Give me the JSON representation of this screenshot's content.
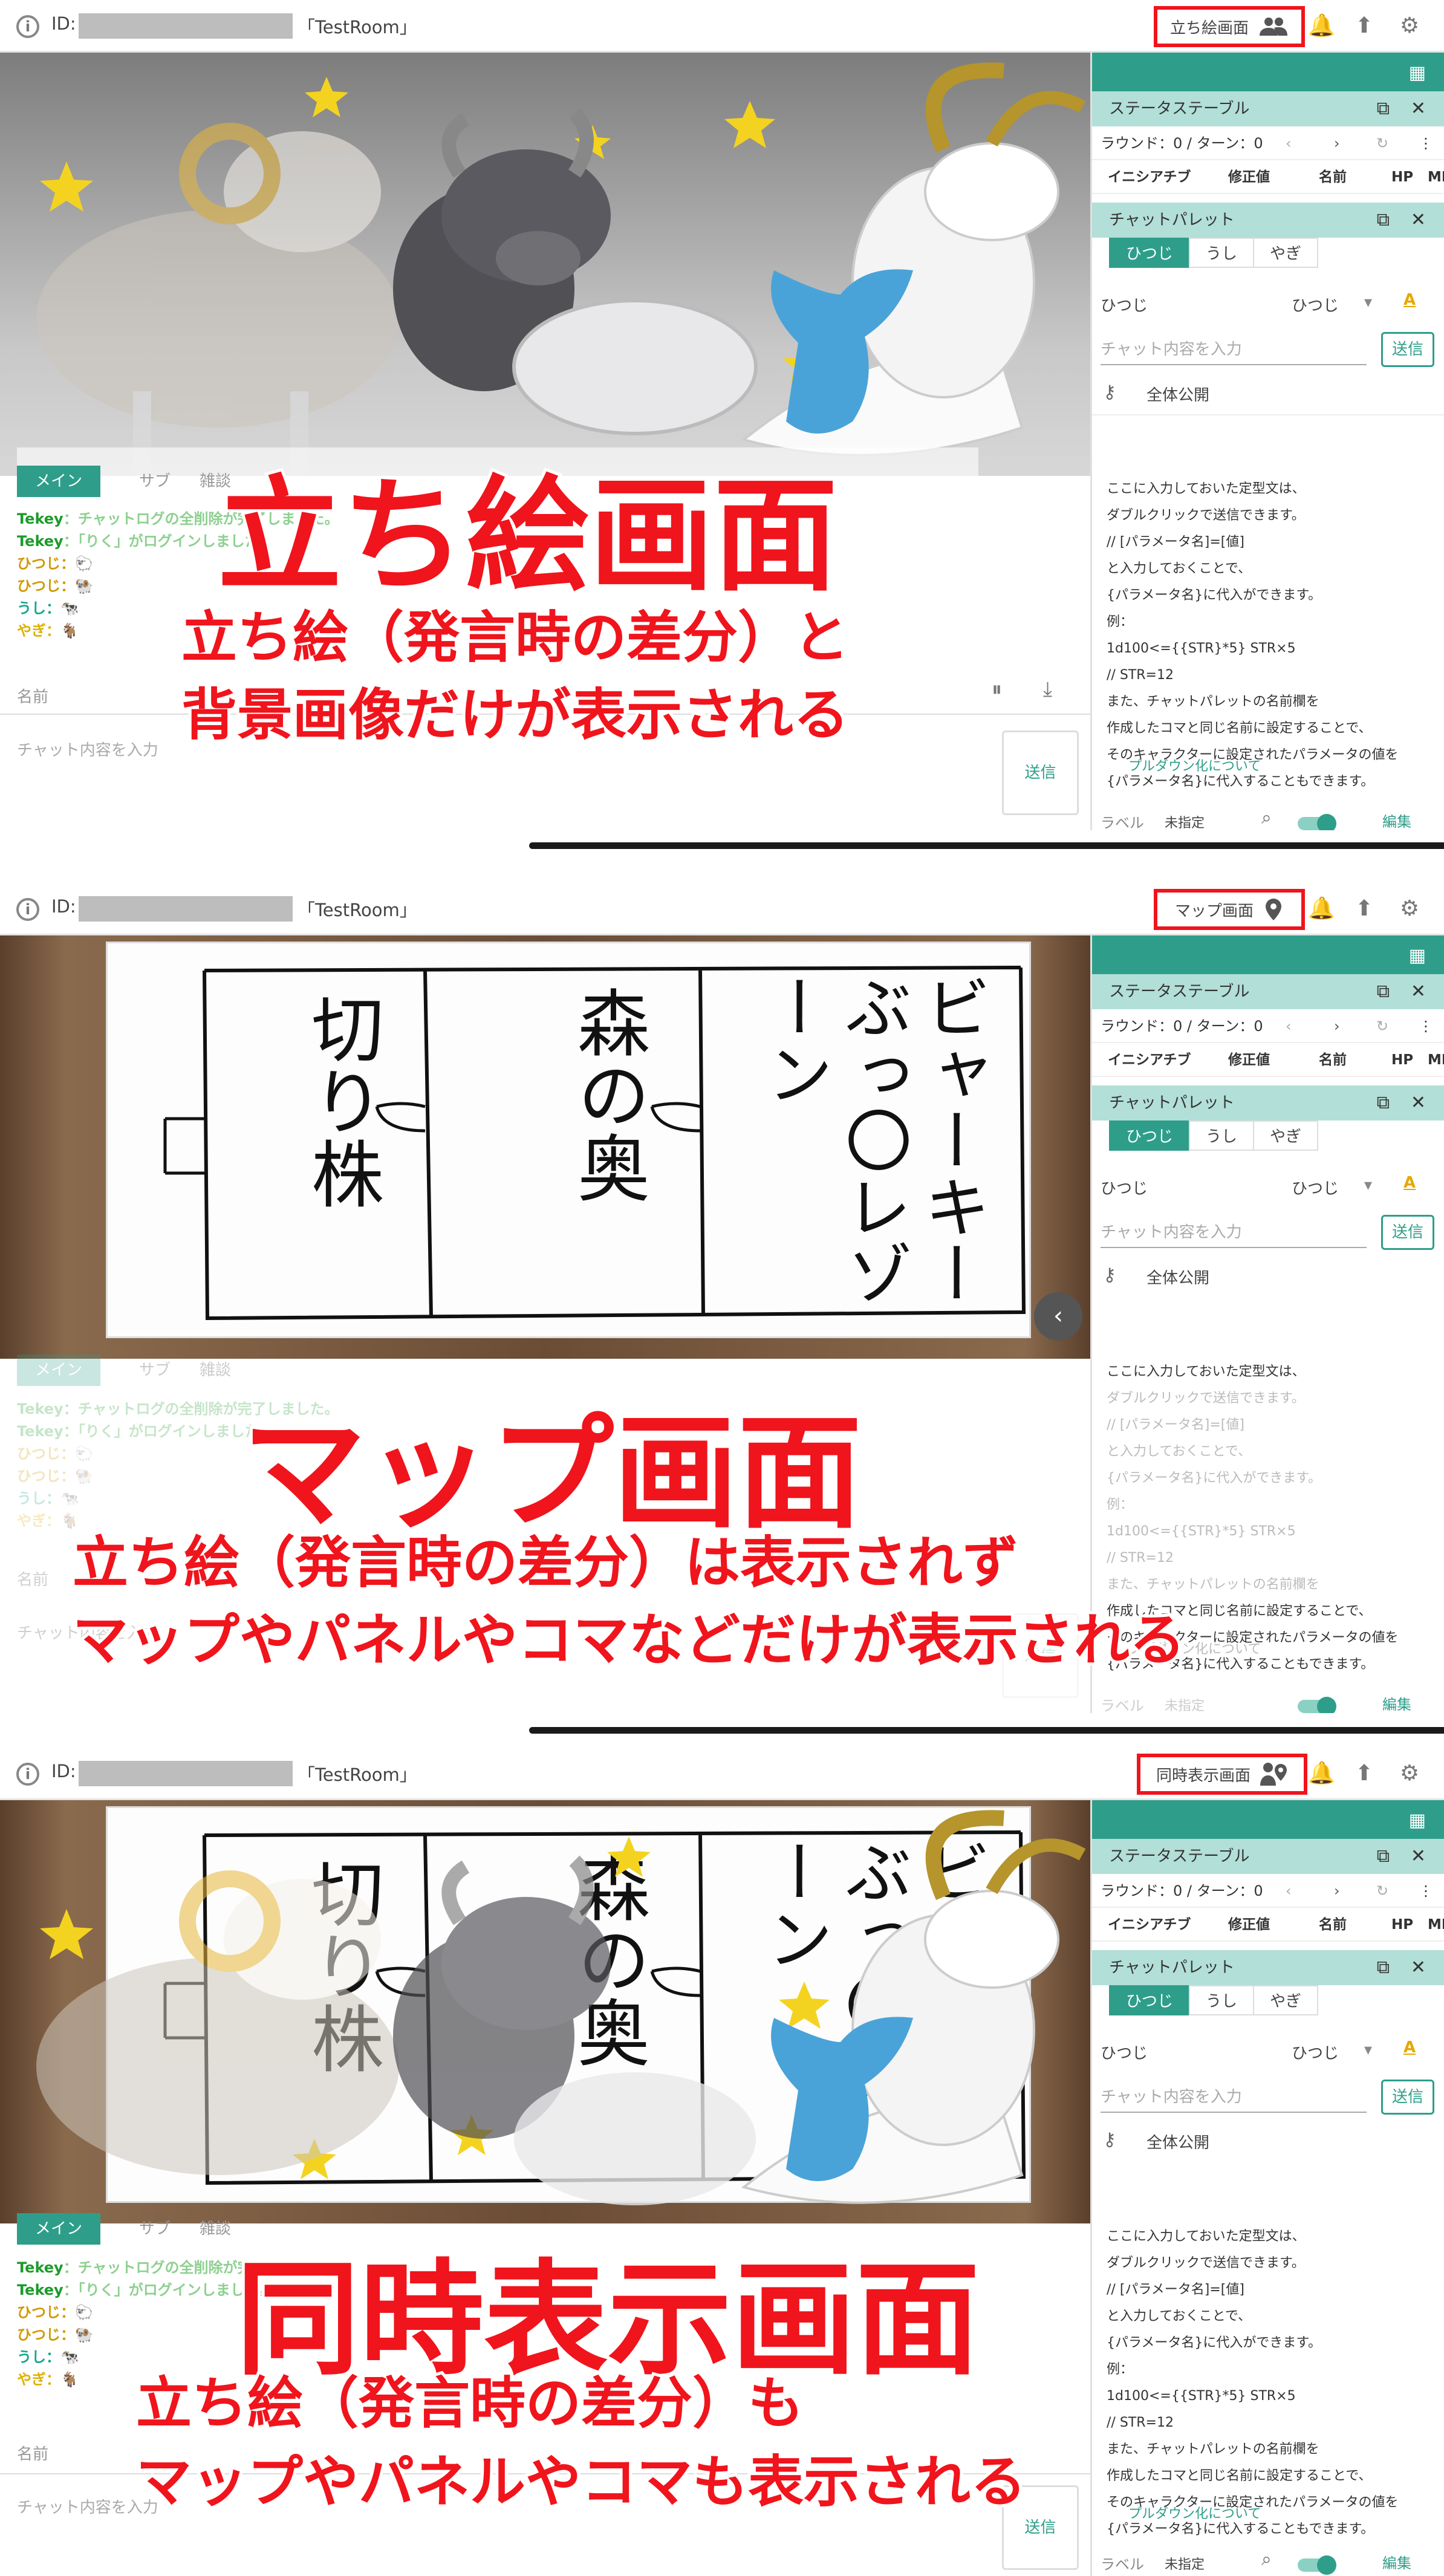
{
  "common": {
    "id_label": "ID:",
    "room_name": "「TestRoom」",
    "sidebar": {
      "status_table": "ステータステーブル",
      "round_turn": "ラウンド：0 / ターン：0",
      "columns": [
        "イニシアチブ",
        "修正値",
        "名前",
        "HP",
        "MP"
      ],
      "chat_palette": "チャットパレット",
      "palette_tabs": [
        "ひつじ",
        "うし",
        "やぎ"
      ],
      "speaker_label": "ひつじ",
      "speaker_select": "ひつじ",
      "chat_placeholder": "チャット内容を入力",
      "send": "送信",
      "visibility": "全体公開",
      "help_lines": [
        "ここに入力しておいた定型文は、",
        "ダブルクリックで送信できます。",
        "// [パラメータ名]=[値]",
        "と入力しておくことで、",
        "{パラメータ名}に代入ができます。",
        "例：",
        "1d100<={{STR}*5} STR×5",
        "// STR=12",
        "また、チャットパレットの名前欄を",
        "作成したコマと同じ名前に設定することで、",
        "そのキャラクターに設定されたパラメータの値を",
        "{パラメータ名}に代入することもできます。"
      ],
      "pulldown": "プルダウン化について",
      "label_text": "ラベル",
      "label_value": "未指定",
      "edit": "編集"
    },
    "chat": {
      "tabs": [
        "メイン",
        "サブ",
        "雑談"
      ],
      "log": [
        {
          "name": "Tekey",
          "text": "：チャットログの全削除が完了しました。"
        },
        {
          "name": "Tekey",
          "text": "：「りく」がログインしました。"
        },
        {
          "name": "ひつじ",
          "text": "：🐑"
        },
        {
          "name": "ひつじ",
          "text": "：🐏"
        },
        {
          "name": "うし",
          "text": "：🐄"
        },
        {
          "name": "やぎ",
          "text": "：🐐"
        }
      ],
      "name_placeholder": "名前",
      "message_placeholder": "チャット内容を入力",
      "send": "送信"
    },
    "map_sheets": [
      "切り株",
      "森の奥",
      "ビャーキーぶっ〇レゾーン"
    ]
  },
  "panels": [
    {
      "mode_label": "立ち絵画面",
      "mode_icon": "people-icon",
      "title": "立ち絵画面",
      "lines": [
        "立ち絵（発言時の差分）と",
        "背景画像だけが表示される"
      ]
    },
    {
      "mode_label": "マップ画面",
      "mode_icon": "map-pin-icon",
      "title": "マップ画面",
      "lines": [
        "立ち絵（発言時の差分）は表示されず",
        "マップやパネルやコマなどだけが表示される"
      ]
    },
    {
      "mode_label": "同時表示画面",
      "mode_icon": "person-map-icon",
      "title": "同時表示画面",
      "lines": [
        "立ち絵（発言時の差分）も",
        "マップやパネルやコマも表示される"
      ]
    }
  ],
  "colors": {
    "accent": "#2e9e8a",
    "accent_light": "#b2dfd7",
    "highlight_red": "#f0141c"
  }
}
